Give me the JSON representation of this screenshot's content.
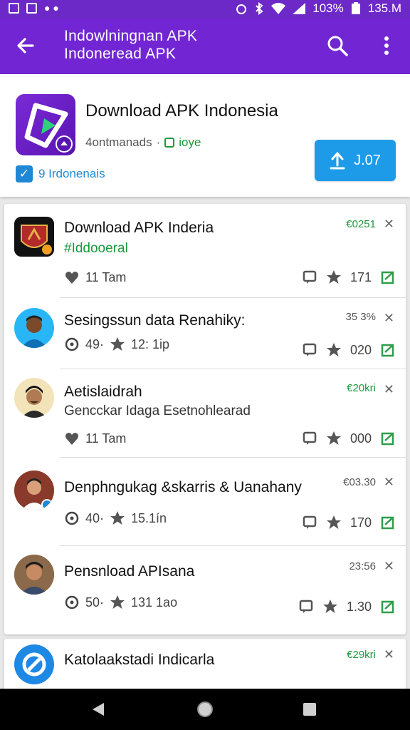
{
  "status": {
    "left_icons": [
      "image-icon",
      "photo-icon",
      "dots-icon"
    ],
    "battery": "103%",
    "clock": "135.M"
  },
  "appbar": {
    "title_line1": "Indowlningnan APK",
    "title_line2": "Indoneread APK"
  },
  "app": {
    "name": "Download APK Indonesia",
    "downloads": "4ontmanads",
    "badge": "ioye",
    "verified": "9 Irdonenais",
    "button_label": "J.07"
  },
  "feed": [
    {
      "title": "Download APK Inderia",
      "subtitle": "#Iddooeral",
      "subtitle_color": "#1b9a3c",
      "time": "€0251",
      "time_color": "#1b9a3c",
      "left_icon": "heart-icon",
      "left_stat": "11 Tam",
      "left_stat2": "",
      "right_stat": "171"
    },
    {
      "title": "Sesingssun data Renahiky:",
      "subtitle": "",
      "subtitle_color": "#333",
      "time": "35 3%",
      "time_color": "#555",
      "left_icon": "clock-icon",
      "left_stat": "49·",
      "left_stat2": "12: 1ip",
      "right_stat": "020"
    },
    {
      "title": "Aetislaidrah",
      "subtitle": "Gencckar Idaga Esetnohlearad",
      "subtitle_color": "#333",
      "time": "€20kri",
      "time_color": "#1b9a3c",
      "left_icon": "heart-icon",
      "left_stat": "11 Tam",
      "left_stat2": "",
      "right_stat": "000"
    },
    {
      "title": "Denphngukag &skarris & Uanahany",
      "subtitle": "",
      "subtitle_color": "#333",
      "time": "€03.30",
      "time_color": "#555",
      "left_icon": "clock-icon",
      "left_stat": "40·",
      "left_stat2": "15.1ín",
      "right_stat": "170"
    },
    {
      "title": "Pensnload APIsana",
      "subtitle": "",
      "subtitle_color": "#333",
      "time": "23:56",
      "time_color": "#555",
      "left_icon": "clock-icon",
      "left_stat": "50·",
      "left_stat2": "131 1ao",
      "right_stat": "1.30"
    }
  ],
  "card2": {
    "title": "Katolaakstadi Indicarla",
    "time": "€29kri",
    "time_color": "#1b9a3c"
  },
  "colors": {
    "accent": "#7226d3",
    "button": "#1d9be8",
    "green": "#1b9a3c"
  }
}
